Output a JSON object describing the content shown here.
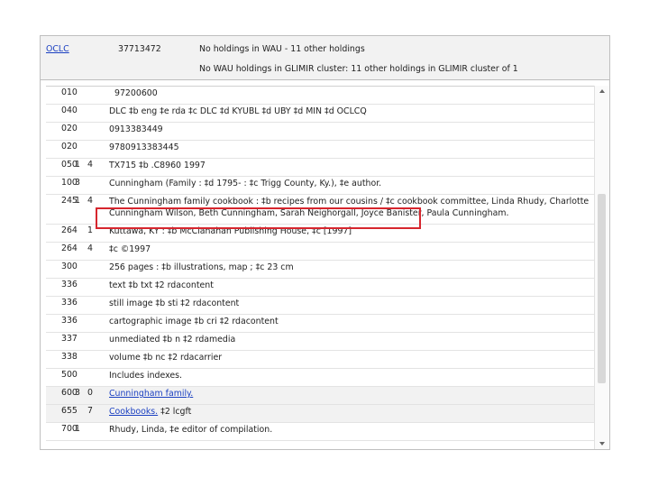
{
  "header": {
    "oclc_label": "OCLC",
    "oclc_number": "37713472",
    "holdings_line1": "No holdings in WAU - 11 other holdings",
    "holdings_line2": "No WAU holdings in GLIMIR cluster: 11 other holdings in GLIMIR cluster of 1"
  },
  "rows": [
    {
      "tag": "010",
      "ind1": "",
      "ind2": "",
      "text": "  97200600"
    },
    {
      "tag": "040",
      "ind1": "",
      "ind2": "",
      "text": "DLC ‡b eng ‡e rda ‡c DLC ‡d KYUBL ‡d UBY ‡d MIN ‡d OCLCQ"
    },
    {
      "tag": "020",
      "ind1": "",
      "ind2": "",
      "text": "0913383449"
    },
    {
      "tag": "020",
      "ind1": "",
      "ind2": "",
      "text": "9780913383445"
    },
    {
      "tag": "050",
      "ind1": "1",
      "ind2": "4",
      "text": "TX715 ‡b .C8960 1997"
    },
    {
      "tag": "100",
      "ind1": "3",
      "ind2": "",
      "text": "Cunningham (Family : ‡d 1795- : ‡c Trigg County, Ky.), ‡e author."
    },
    {
      "tag": "245",
      "ind1": "1",
      "ind2": "4",
      "text": "The Cunningham family cookbook : ‡b recipes from our cousins / ‡c cookbook committee, Linda Rhudy, Charlotte Cunningham Wilson, Beth Cunningham, Sarah Neighorgall, Joyce Banister, Paula Cunningham."
    },
    {
      "tag": "264",
      "ind1": "",
      "ind2": "1",
      "text": "Kuttawa, KY : ‡b McClanahan Publishing House, ‡c [1997]"
    },
    {
      "tag": "264",
      "ind1": "",
      "ind2": "4",
      "text": "‡c ©1997"
    },
    {
      "tag": "300",
      "ind1": "",
      "ind2": "",
      "text": "256 pages : ‡b illustrations, map ; ‡c 23 cm"
    },
    {
      "tag": "336",
      "ind1": "",
      "ind2": "",
      "text": "text ‡b txt ‡2 rdacontent"
    },
    {
      "tag": "336",
      "ind1": "",
      "ind2": "",
      "text": "still image ‡b sti ‡2 rdacontent"
    },
    {
      "tag": "336",
      "ind1": "",
      "ind2": "",
      "text": "cartographic image ‡b cri ‡2 rdacontent"
    },
    {
      "tag": "337",
      "ind1": "",
      "ind2": "",
      "text": "unmediated ‡b n ‡2 rdamedia"
    },
    {
      "tag": "338",
      "ind1": "",
      "ind2": "",
      "text": "volume ‡b nc ‡2 rdacarrier"
    },
    {
      "tag": "500",
      "ind1": "",
      "ind2": "",
      "text": "Includes indexes."
    },
    {
      "tag": "600",
      "ind1": "3",
      "ind2": "0",
      "link": "Cunningham family.",
      "rest": ""
    },
    {
      "tag": "655",
      "ind1": "",
      "ind2": "7",
      "link": "Cookbooks.",
      "rest": " ‡2 lcgft"
    },
    {
      "tag": "700",
      "ind1": "1",
      "ind2": "",
      "text": "Rhudy, Linda, ‡e editor of compilation."
    }
  ],
  "colors": {
    "highlight": "#d6262e",
    "link": "#1a3fc1",
    "header_bg": "#f2f2f2"
  }
}
